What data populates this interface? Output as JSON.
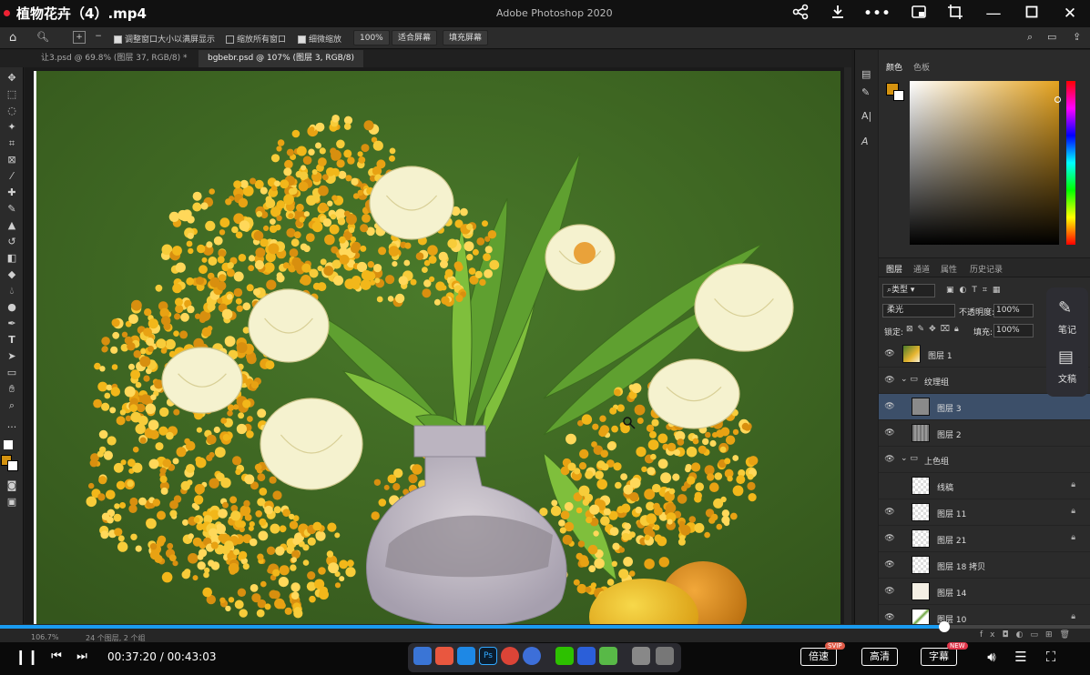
{
  "video": {
    "title": "植物花卉（4）.mp4",
    "current_time": "00:37:20",
    "total_time": "00:43:03",
    "progress": 0.8667,
    "speed_label": "倍速",
    "speed_badge": "SVIP",
    "quality_label": "高清",
    "subtitle_label": "字幕",
    "subtitle_badge": "NEW"
  },
  "app": {
    "name": "Adobe Photoshop 2020"
  },
  "options": {
    "resize_windows": "调整窗口大小以满屏显示",
    "zoom_all": "缩放所有窗口",
    "scrubby_zoom": "细微缩放",
    "zoom_value": "100%",
    "fit_screen": "适合屏幕",
    "fill_screen": "填充屏幕",
    "resize_checked": true,
    "zoom_all_checked": false,
    "scrubby_checked": true
  },
  "tabs": [
    {
      "label": "让3.psd @ 69.8% (图层 37, RGB/8) *",
      "active": false
    },
    {
      "label": "bgbebr.psd @ 107% (图层 3, RGB/8)",
      "active": true
    }
  ],
  "color_panel": {
    "tabs": [
      "颜色",
      "色板"
    ],
    "foreground": "#d4920f",
    "background": "#ffffff"
  },
  "layers_panel": {
    "tabs": [
      "图层",
      "通道",
      "属性",
      "历史记录"
    ],
    "filter_label": "类型",
    "blend_mode": "柔光",
    "opacity_label": "不透明度:",
    "opacity_value": "100%",
    "lock_label": "锁定:",
    "fill_label": "填充:",
    "fill_value": "100%",
    "layers": [
      {
        "name": "图层 1",
        "indent": 0,
        "visible": true,
        "type": "image",
        "locked": false,
        "selected": false
      },
      {
        "name": "纹理组",
        "indent": 0,
        "visible": true,
        "type": "group",
        "locked": false,
        "selected": false
      },
      {
        "name": "图层 3",
        "indent": 1,
        "visible": true,
        "type": "gray",
        "locked": false,
        "selected": true
      },
      {
        "name": "图层 2",
        "indent": 1,
        "visible": true,
        "type": "texture",
        "locked": false,
        "selected": false
      },
      {
        "name": "上色组",
        "indent": 0,
        "visible": true,
        "type": "group",
        "locked": false,
        "selected": false
      },
      {
        "name": "线稿",
        "indent": 1,
        "visible": false,
        "type": "empty",
        "locked": true,
        "selected": false
      },
      {
        "name": "图层 11",
        "indent": 1,
        "visible": true,
        "type": "empty",
        "locked": true,
        "selected": false
      },
      {
        "name": "图层 21",
        "indent": 1,
        "visible": true,
        "type": "empty",
        "locked": true,
        "selected": false
      },
      {
        "name": "图层 18 拷贝",
        "indent": 1,
        "visible": true,
        "type": "empty",
        "locked": false,
        "selected": false
      },
      {
        "name": "图层 14",
        "indent": 1,
        "visible": true,
        "type": "sketch",
        "locked": false,
        "selected": false
      },
      {
        "name": "图层 10",
        "indent": 1,
        "visible": true,
        "type": "leaf",
        "locked": true,
        "selected": false
      }
    ]
  },
  "side_widget": {
    "notes": "笔记",
    "draft": "文稿"
  },
  "status": {
    "zoom": "106.7%",
    "info": "24 个图层, 2 个组"
  },
  "colors": {
    "accent": "#1a9bf0",
    "canvas_green": "#3f6a22",
    "flower_yellow": "#f2b71a"
  }
}
